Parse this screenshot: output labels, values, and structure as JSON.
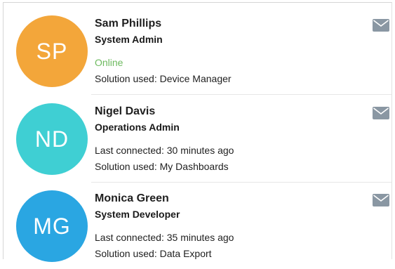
{
  "users": [
    {
      "initials": "SP",
      "avatar_color": "#f3a63a",
      "name": "Sam Phillips",
      "role": "System Admin",
      "status": "Online",
      "status_color": "#6dba5f",
      "solution": "Solution used: Device Manager",
      "mail_icon": "mail-icon"
    },
    {
      "initials": "ND",
      "avatar_color": "#3fcfd3",
      "name": "Nigel Davis",
      "role": "Operations Admin",
      "status": "Last connected: 30 minutes ago",
      "status_color": "#1f1f1f",
      "solution": "Solution used: My Dashboards",
      "mail_icon": "mail-icon"
    },
    {
      "initials": "MG",
      "avatar_color": "#2aa6e2",
      "name": "Monica Green",
      "role": "System Developer",
      "status": "Last connected: 35 minutes ago",
      "status_color": "#1f1f1f",
      "solution": "Solution used: Data Export",
      "mail_icon": "mail-icon"
    }
  ],
  "colors": {
    "mail_icon": "#8a97a3",
    "divider": "#e6e6e6"
  }
}
